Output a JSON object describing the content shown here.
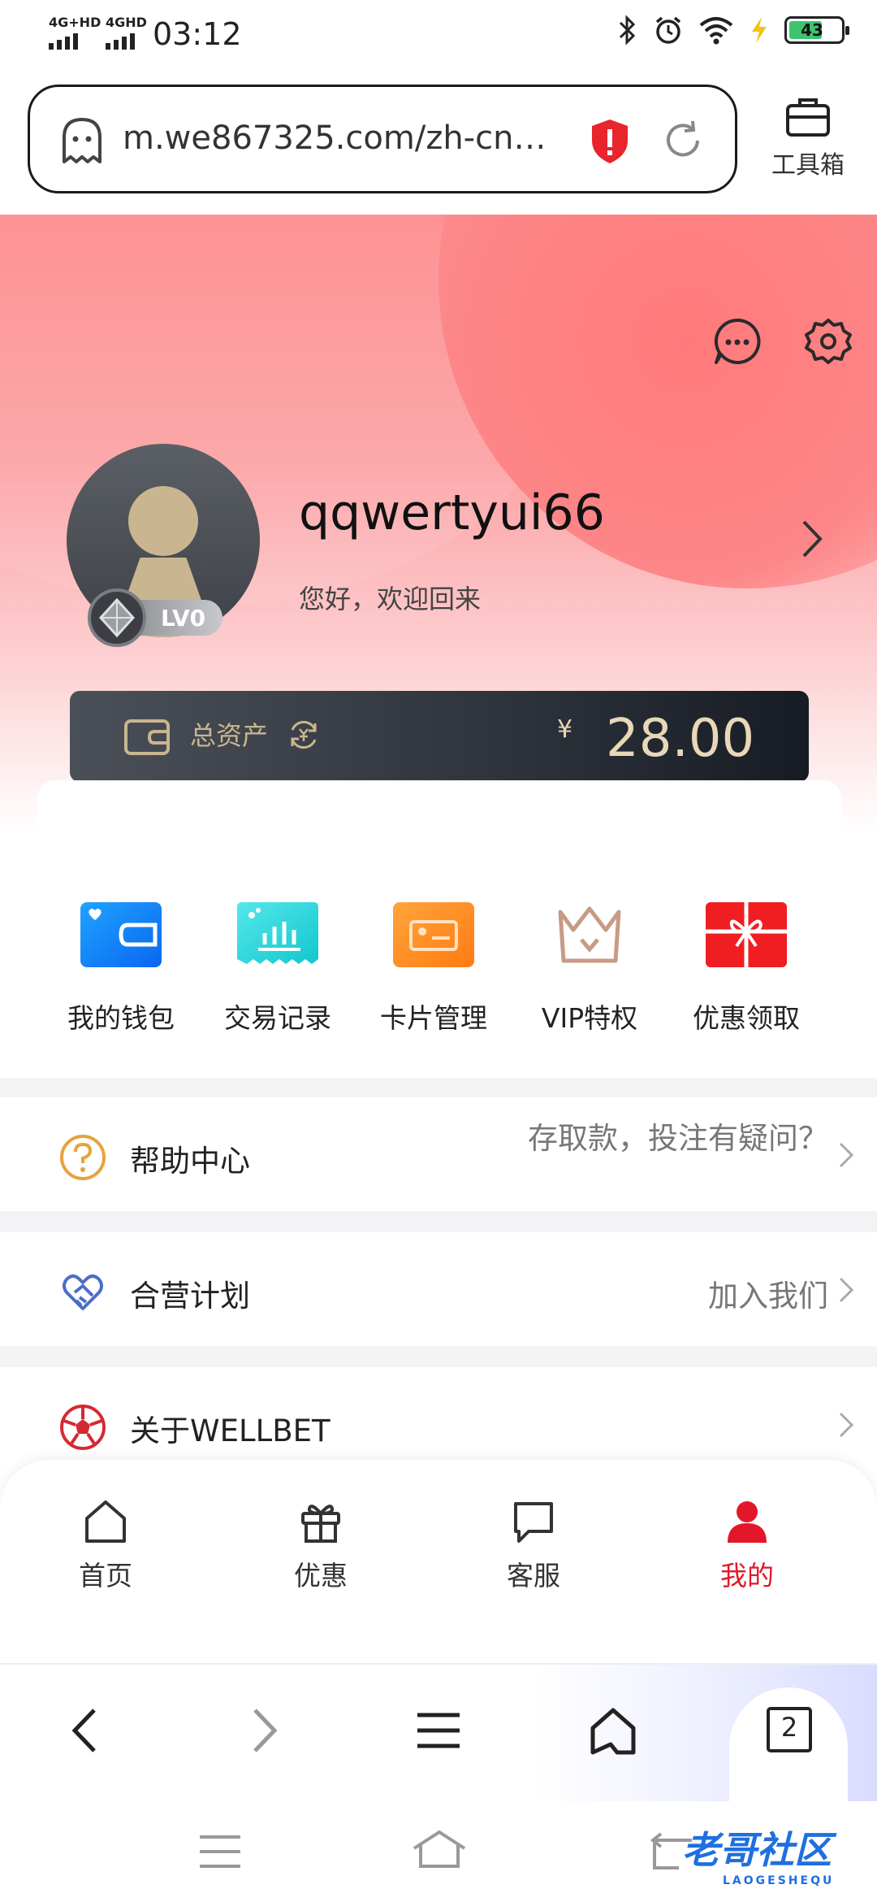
{
  "status_bar": {
    "signal1": "4G+HD",
    "signal2": "4GHD",
    "time": "03:12",
    "battery": "43"
  },
  "browser": {
    "url": "m.we867325.com/zh-cn…",
    "toolbox_label": "工具箱"
  },
  "profile": {
    "username": "qqwertyui66",
    "greeting": "您好，欢迎回来",
    "level": "LV0"
  },
  "assets": {
    "label": "总资产",
    "currency": "¥",
    "amount": "28.00"
  },
  "quick_menu": [
    {
      "label": "我的钱包",
      "icon": "wallet-card-icon"
    },
    {
      "label": "交易记录",
      "icon": "receipt-chart-icon"
    },
    {
      "label": "卡片管理",
      "icon": "card-manage-icon"
    },
    {
      "label": "VIP特权",
      "icon": "crown-icon"
    },
    {
      "label": "优惠领取",
      "icon": "gift-box-icon"
    }
  ],
  "list": [
    {
      "label": "帮助中心",
      "desc": "存取款，投注有疑问？",
      "icon": "question-circle-icon"
    },
    {
      "label": "合营计划",
      "desc": "加入我们",
      "icon": "handshake-icon"
    },
    {
      "label": "关于WELLBET",
      "desc": "",
      "icon": "soccer-ball-icon"
    }
  ],
  "bottom_nav": [
    {
      "label": "首页",
      "icon": "home-icon"
    },
    {
      "label": "优惠",
      "icon": "gift-icon"
    },
    {
      "label": "客服",
      "icon": "chat-icon"
    },
    {
      "label": "我的",
      "icon": "user-icon"
    }
  ],
  "browser_bar": {
    "tab_count": "2"
  },
  "watermark": {
    "text": "老哥社区",
    "sub": "LAOGESHEQU"
  },
  "colors": {
    "accent_red": "#e2182a",
    "gold": "#c9b690",
    "hero_pink": "#fd8a8c"
  }
}
